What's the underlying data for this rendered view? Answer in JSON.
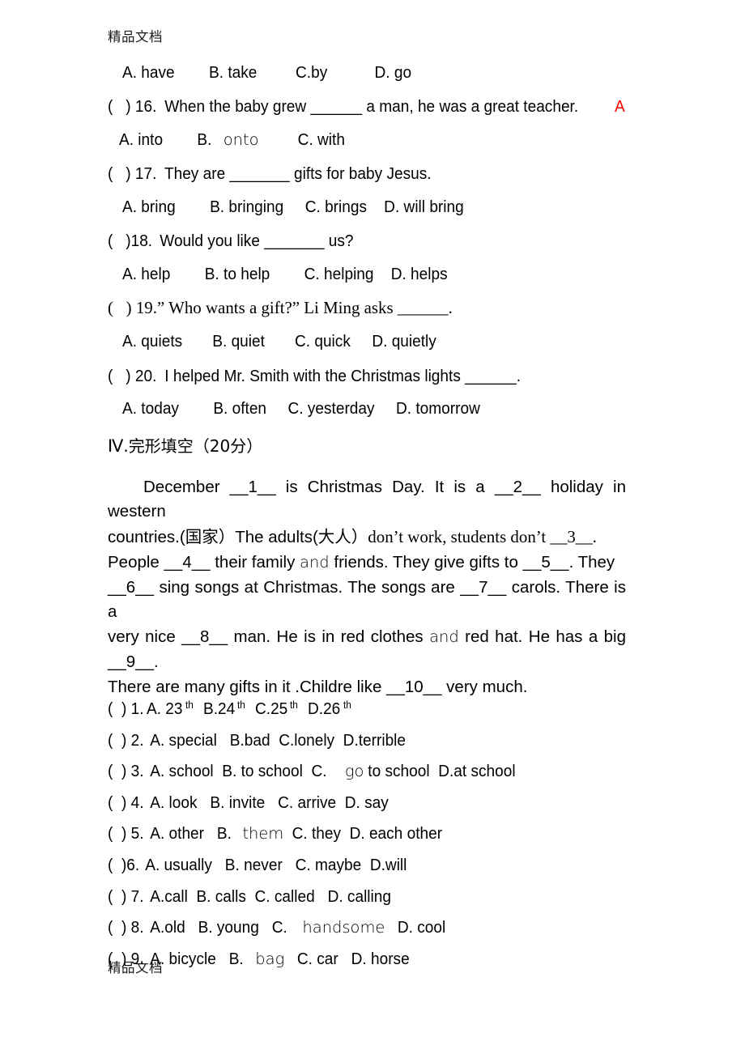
{
  "document": {
    "watermark": "精品文档"
  },
  "multiple_choice": {
    "leading_options": {
      "text": "A. have        B. take         C.by           D. go",
      "a": "A. have",
      "b": "B. take",
      "c": "C.by",
      "d": "D. go"
    },
    "questions": [
      {
        "marker": "(   ) 16.",
        "stem": " When the baby grew ______ a man, he was a great teacher. ",
        "answer": "A",
        "options": "A. into        B. onto         C. with",
        "options_pre": "A. into        B. ",
        "options_light": "onto",
        "options_post": "         C. with"
      },
      {
        "marker": "(   ) 17.",
        "stem": " They are _______ gifts for baby Jesus.",
        "answer": "",
        "options": "A. bring        B. bringing     C. brings    D. will bring"
      },
      {
        "marker": "(   )18.",
        "stem": " Would you like _______ us?",
        "answer": "",
        "options": "A. help        B. to help        C. helping    D. helps"
      },
      {
        "marker": "(   ) 19.",
        "stem": "” Who wants a gift?” Li Ming asks ______.",
        "answer": "",
        "options": "A. quiets       B. quiet       C. quick     D. quietly"
      },
      {
        "marker": "(   ) 20.",
        "stem": " I helped Mr. Smith with the Christmas lights ______.",
        "answer": "",
        "options": "A. today        B. often     C. yesterday     D. tomorrow"
      }
    ]
  },
  "cloze_section": {
    "numeral": "Ⅳ",
    "title": ".完形填空（20分）",
    "passage": {
      "line1": "December __1__ is Christmas Day. It is a __2__ holiday in western",
      "line2_a": "countries.(",
      "line2_cjk1": "国家",
      "line2_b": "）The adults(",
      "line2_cjk2": "大人",
      "line2_c": "）",
      "line2_serif": "don’t work,  students  don’t  __3__.",
      "line3_a": "People __4__ their family ",
      "line3_light": "and",
      "line3_b": " friends. They give gifts to __5__. They",
      "line4_a": "__6__ sing songs  at Christmas. The songs are __7__ carols. There is a",
      "line5_a": "very nice __8__ man. He is in red clothes ",
      "line5_light": "and",
      "line5_b": " red hat. He has a big __9__.",
      "line6": "There are many gifts in it .Childre like __10__ very much."
    },
    "items": [
      {
        "marker": "(  ) 1.",
        "a": "A. 23",
        "a_sup": "th",
        "b": "B.24",
        "b_sup": "th",
        "c": "C.25",
        "c_sup": "th",
        "d": "D.26",
        "d_sup": "th"
      },
      {
        "marker": "(  ) 2.",
        "text": " A. special   B.bad  C.lonely  D.terrible"
      },
      {
        "marker": "(  ) 3.",
        "pre": " A. school  B. to school  C. ",
        "light": "go",
        "post": " to school  D.at school"
      },
      {
        "marker": "(  ) 4.",
        "text": " A. look   B. invite   C. arrive  D. say"
      },
      {
        "marker": "(  ) 5.",
        "pre": " A. other   B. ",
        "light": "them",
        "post": "  C. they  D. each other"
      },
      {
        "marker": "(  )6.",
        "text": " A. usually   B. never   C. maybe  D.will"
      },
      {
        "marker": "(  ) 7.",
        "text": " A.call  B. calls  C. called   D. calling"
      },
      {
        "marker": "(  ) 8.",
        "pre": " A.old   B. young   C. ",
        "light": "handsome",
        "post": "   D. cool"
      },
      {
        "marker": "(  ) 9.",
        "pre": " A. bicycle   B. ",
        "light": "bag",
        "post": "   C. car   D. horse"
      }
    ]
  },
  "colors": {
    "answer_red": "#ff0000",
    "text_black": "#000000",
    "page_background": "#ffffff"
  }
}
